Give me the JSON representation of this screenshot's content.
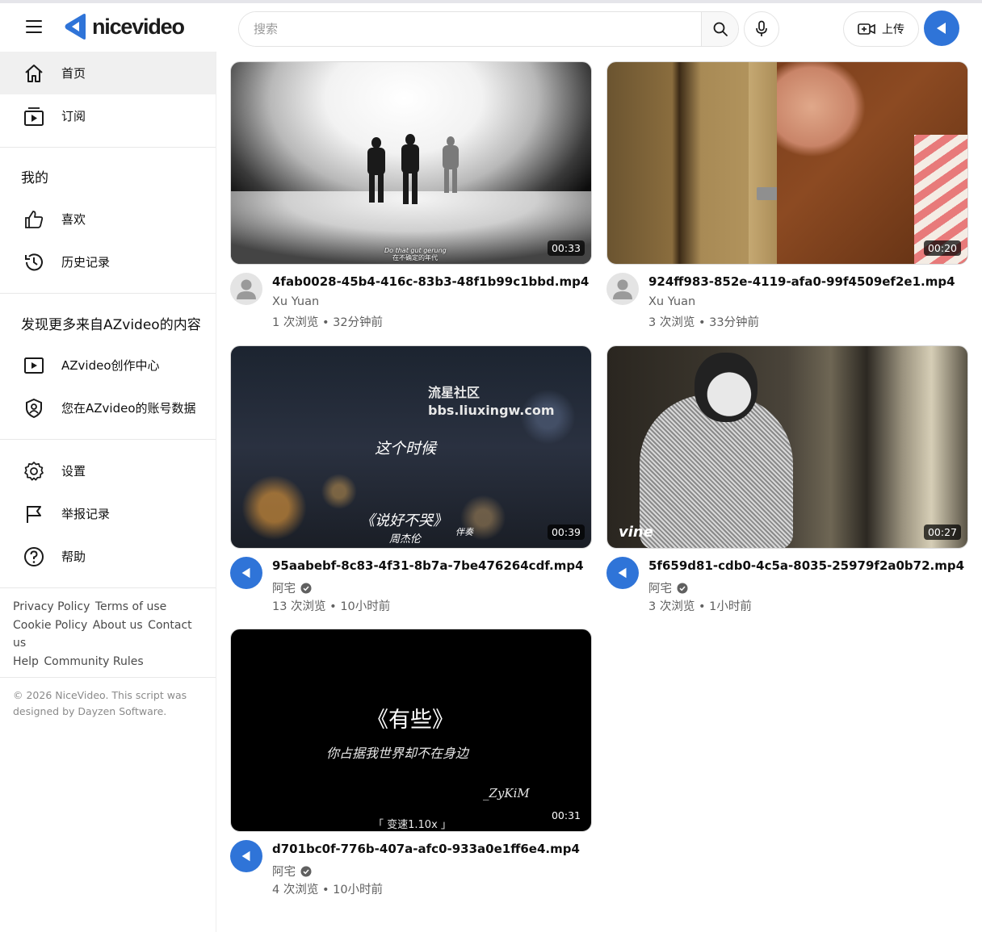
{
  "header": {
    "logo_text": "nicevideo",
    "search_placeholder": "搜索",
    "upload_label": "上传"
  },
  "sidebar": {
    "primary": [
      {
        "label": "首页",
        "icon": "home-icon",
        "active": true
      },
      {
        "label": "订阅",
        "icon": "subscriptions-icon"
      }
    ],
    "mine_title": "我的",
    "mine": [
      {
        "label": "喜欢",
        "icon": "thumbs-up-icon"
      },
      {
        "label": "历史记录",
        "icon": "history-icon"
      }
    ],
    "discover_title": "发现更多来自AZvideo的内容",
    "discover": [
      {
        "label": "AZvideo创作中心",
        "icon": "studio-icon"
      },
      {
        "label": "您在AZvideo的账号数据",
        "icon": "account-shield-icon"
      }
    ],
    "settings": [
      {
        "label": "设置",
        "icon": "gear-icon"
      },
      {
        "label": "举报记录",
        "icon": "flag-icon"
      },
      {
        "label": "帮助",
        "icon": "help-icon"
      }
    ],
    "footer_links": {
      "privacy": "Privacy Policy",
      "terms": "Terms of use",
      "cookie": "Cookie Policy",
      "about": "About us",
      "contact": "Contact us",
      "help": "Help",
      "community": "Community Rules"
    },
    "copyright": "© 2026 NiceVideo. This script was designed by Dayzen Software."
  },
  "videos": [
    {
      "title": "4fab0028-45b4-416c-83b3-48f1b99c1bbd.mp4",
      "channel": "Xu Yuan",
      "verified": false,
      "stats": "1 次浏览 • 32分钟前",
      "duration": "00:33",
      "overlay": [
        "Do that gut gerung",
        "在不确定的年代"
      ]
    },
    {
      "title": "924ff983-852e-4119-afa0-99f4509ef2e1.mp4",
      "channel": "Xu Yuan",
      "verified": false,
      "stats": "3 次浏览 • 33分钟前",
      "duration": "00:20",
      "overlay": []
    },
    {
      "title": "95aabebf-8c83-4f31-8b7a-7be476264cdf.mp4",
      "channel": "阿宅",
      "verified": true,
      "stats": "13 次浏览 • 10小时前",
      "duration": "00:39",
      "overlay": [
        "流星社区",
        "bbs.liuxingw.com",
        "这个时候",
        "《说好不哭》",
        "周杰伦",
        "伴奏"
      ]
    },
    {
      "title": "5f659d81-cdb0-4c5a-8035-25979f2a0b72.mp4",
      "channel": "阿宅",
      "verified": true,
      "stats": "3 次浏览 • 1小时前",
      "duration": "00:27",
      "overlay": [
        "vine"
      ]
    },
    {
      "title": "d701bc0f-776b-407a-afc0-933a0e1ff6e4.mp4",
      "channel": "阿宅",
      "verified": true,
      "stats": "4 次浏览 • 10小时前",
      "duration": "00:31",
      "overlay": [
        "《有些》",
        "你占据我世界却不在身边",
        "_ZyKiM",
        "「 变速1.10x 」"
      ]
    }
  ],
  "colors": {
    "accent": "#2f74d8",
    "active_nav_bg": "#f0f0f0",
    "secondary_text": "#606060"
  }
}
